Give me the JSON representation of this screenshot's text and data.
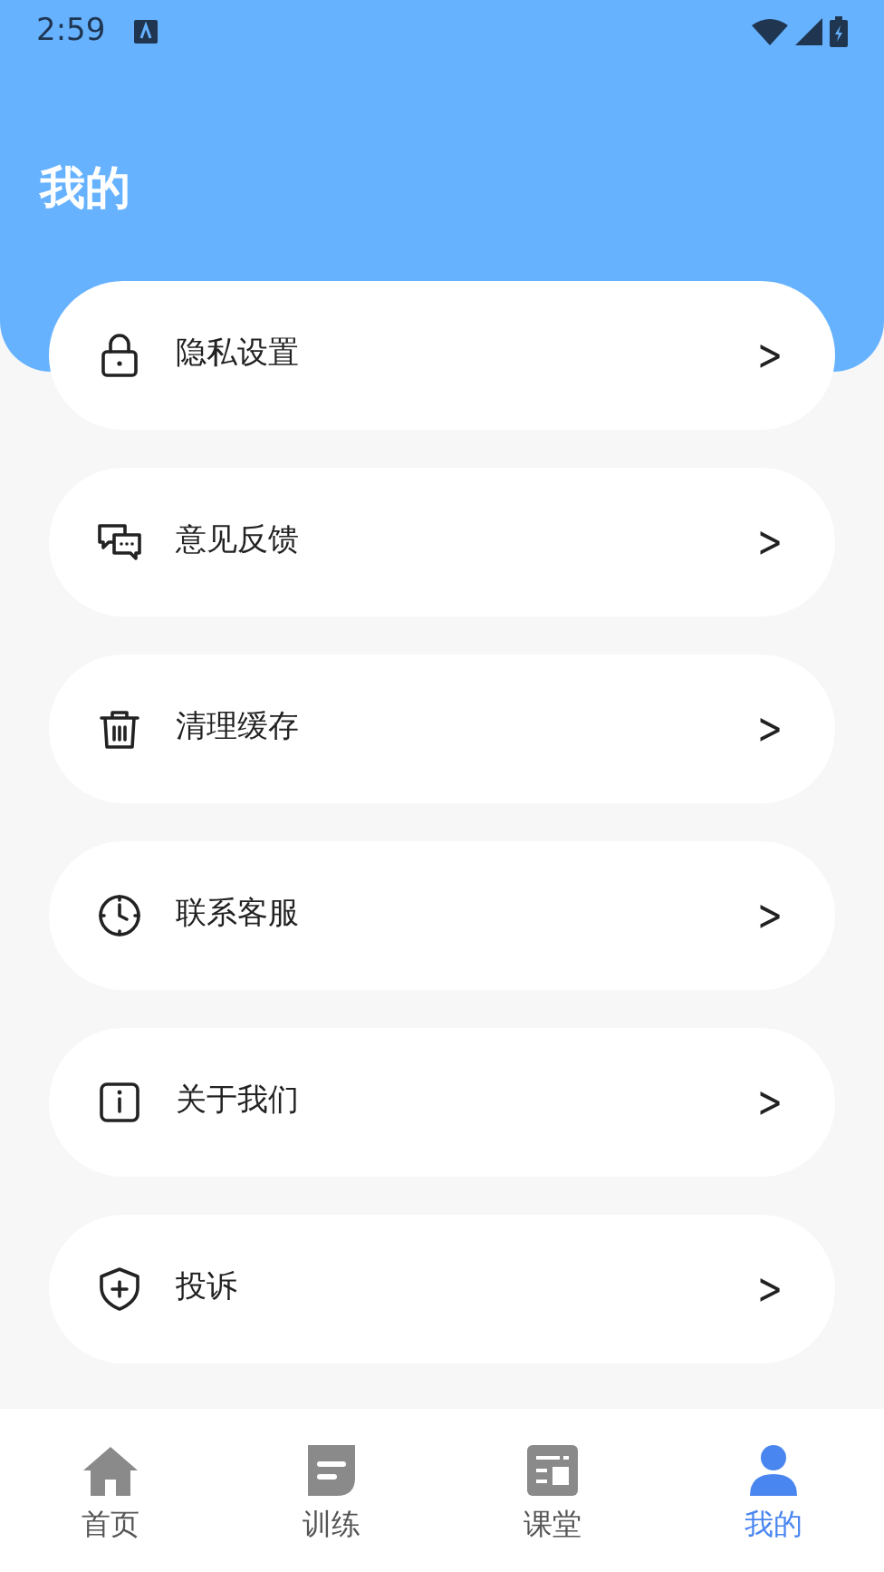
{
  "status_bar": {
    "time": "2:59"
  },
  "header": {
    "title": "我的"
  },
  "menu": [
    {
      "label": "隐私设置",
      "chevron": ">"
    },
    {
      "label": "意见反馈",
      "chevron": ">"
    },
    {
      "label": "清理缓存",
      "chevron": ">"
    },
    {
      "label": "联系客服",
      "chevron": ">"
    },
    {
      "label": "关于我们",
      "chevron": ">"
    },
    {
      "label": "投诉",
      "chevron": ">"
    }
  ],
  "bottom_nav": [
    {
      "label": "首页",
      "selected": false
    },
    {
      "label": "训练",
      "selected": false
    },
    {
      "label": "课堂",
      "selected": false
    },
    {
      "label": "我的",
      "selected": true
    }
  ]
}
